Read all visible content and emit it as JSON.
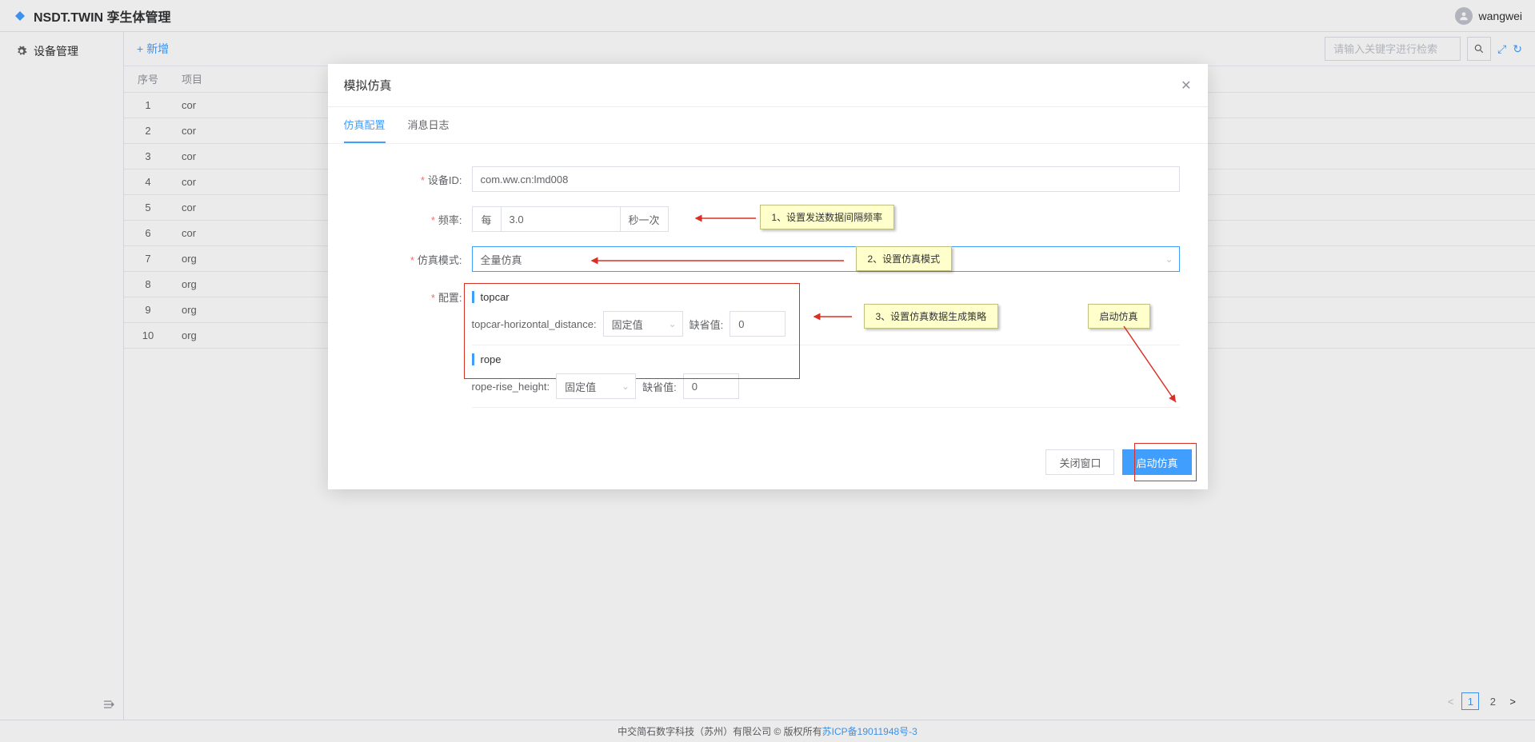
{
  "header": {
    "app_title": "NSDT.TWIN 孪生体管理",
    "username": "wangwei"
  },
  "sidebar": {
    "menu": [
      {
        "label": "设备管理"
      }
    ]
  },
  "toolbar": {
    "add_label": "新增",
    "search_placeholder": "请输入关键字进行检索"
  },
  "table": {
    "columns": {
      "index": "序号",
      "project": "项目"
    },
    "rows": [
      {
        "index": "1",
        "project_prefix": "cor"
      },
      {
        "index": "2",
        "project_prefix": "cor"
      },
      {
        "index": "3",
        "project_prefix": "cor"
      },
      {
        "index": "4",
        "project_prefix": "cor"
      },
      {
        "index": "5",
        "project_prefix": "cor"
      },
      {
        "index": "6",
        "project_prefix": "cor"
      },
      {
        "index": "7",
        "project_prefix": "org"
      },
      {
        "index": "8",
        "project_prefix": "org"
      },
      {
        "index": "9",
        "project_prefix": "org"
      },
      {
        "index": "10",
        "project_prefix": "org"
      }
    ]
  },
  "pagination": {
    "page1": "1",
    "page2": "2"
  },
  "modal": {
    "title": "模拟仿真",
    "tabs": {
      "config": "仿真配置",
      "log": "消息日志"
    },
    "labels": {
      "device_id": "设备ID:",
      "frequency": "频率:",
      "freq_prefix": "每",
      "freq_suffix": "秒一次",
      "mode": "仿真模式:",
      "config": "配置:"
    },
    "values": {
      "device_id": "com.ww.cn:lmd008",
      "frequency": "3.0",
      "mode": "全量仿真"
    },
    "config_groups": {
      "group1": {
        "title": "topcar",
        "field_label": "topcar-horizontal_distance:",
        "type_value": "固定值",
        "default_label": "缺省值:",
        "default_value": "0"
      },
      "group2": {
        "title": "rope",
        "field_label": "rope-rise_height:",
        "type_value": "固定值",
        "default_label": "缺省值:",
        "default_value": "0"
      }
    },
    "buttons": {
      "close": "关闭窗口",
      "start": "启动仿真"
    },
    "callouts": {
      "c1": "1、设置发送数据间隔频率",
      "c2": "2、设置仿真模式",
      "c3": "3、设置仿真数据生成策略",
      "c4": "启动仿真"
    }
  },
  "footer": {
    "company": "中交简石数字科技（苏州）有限公司 © 版权所有",
    "icp": "苏ICP备19011948号-3"
  }
}
